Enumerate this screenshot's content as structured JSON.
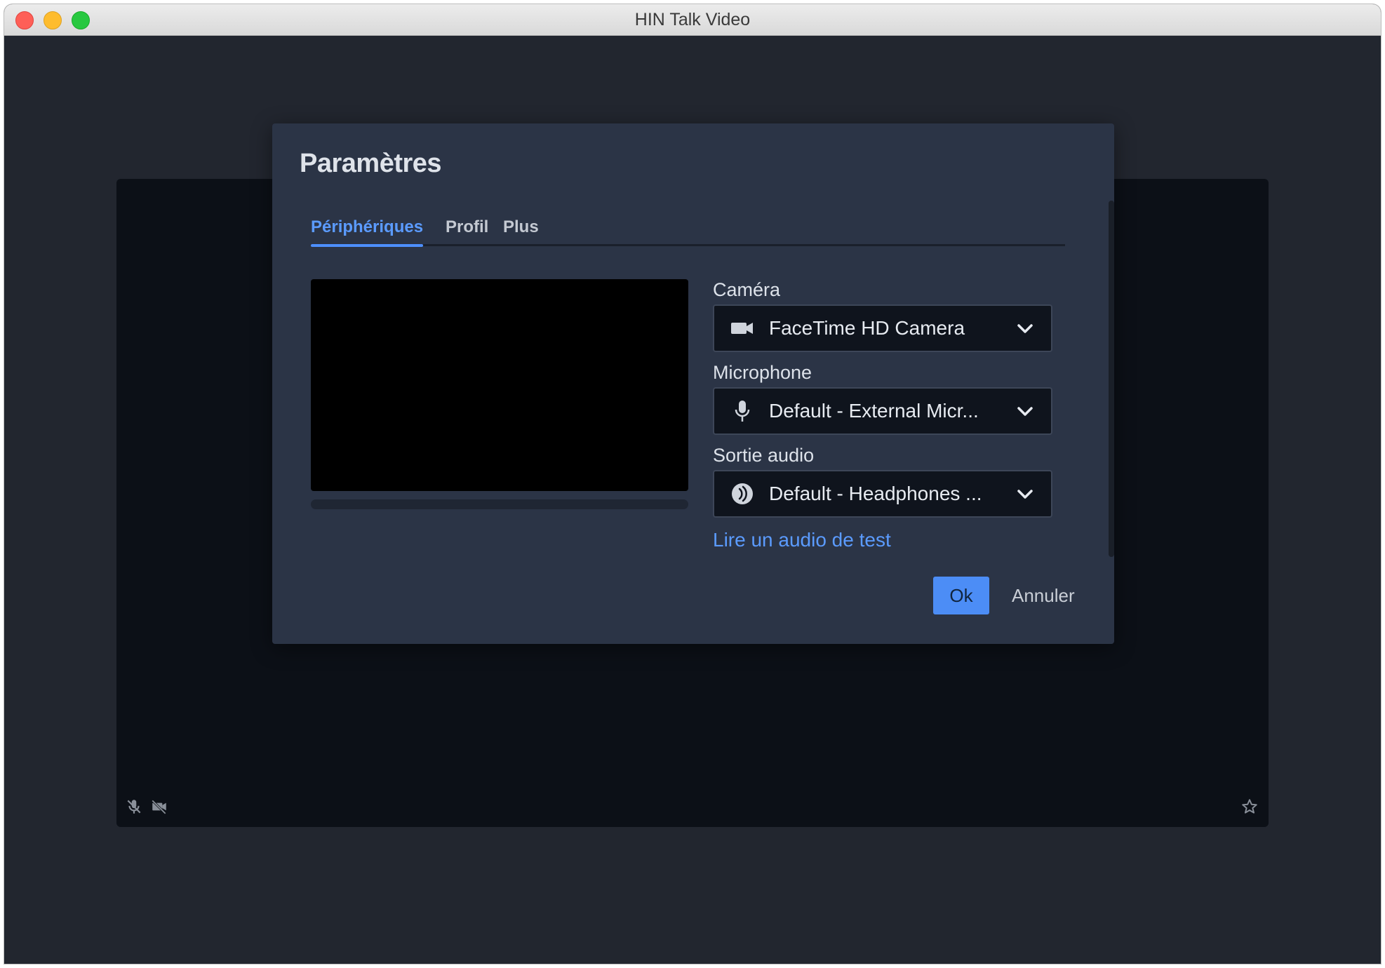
{
  "window": {
    "title": "HIN Talk Video"
  },
  "dialog": {
    "title": "Paramètres",
    "tabs": [
      {
        "label": "Périphériques",
        "active": true
      },
      {
        "label": "Profil",
        "active": false
      },
      {
        "label": "Plus",
        "active": false
      }
    ],
    "camera": {
      "label": "Caméra",
      "value": "FaceTime HD Camera",
      "icon": "video-camera-icon"
    },
    "microphone": {
      "label": "Microphone",
      "value": "Default - External Micr...",
      "icon": "microphone-icon"
    },
    "audio_output": {
      "label": "Sortie audio",
      "value": "Default - Headphones ...",
      "icon": "speaker-icon"
    },
    "test_audio_link": "Lire un audio de test",
    "ok_label": "Ok",
    "cancel_label": "Annuler"
  },
  "colors": {
    "accent": "#4c8df6",
    "dialog_bg": "#2b3446",
    "stage_bg": "#0c1017"
  }
}
